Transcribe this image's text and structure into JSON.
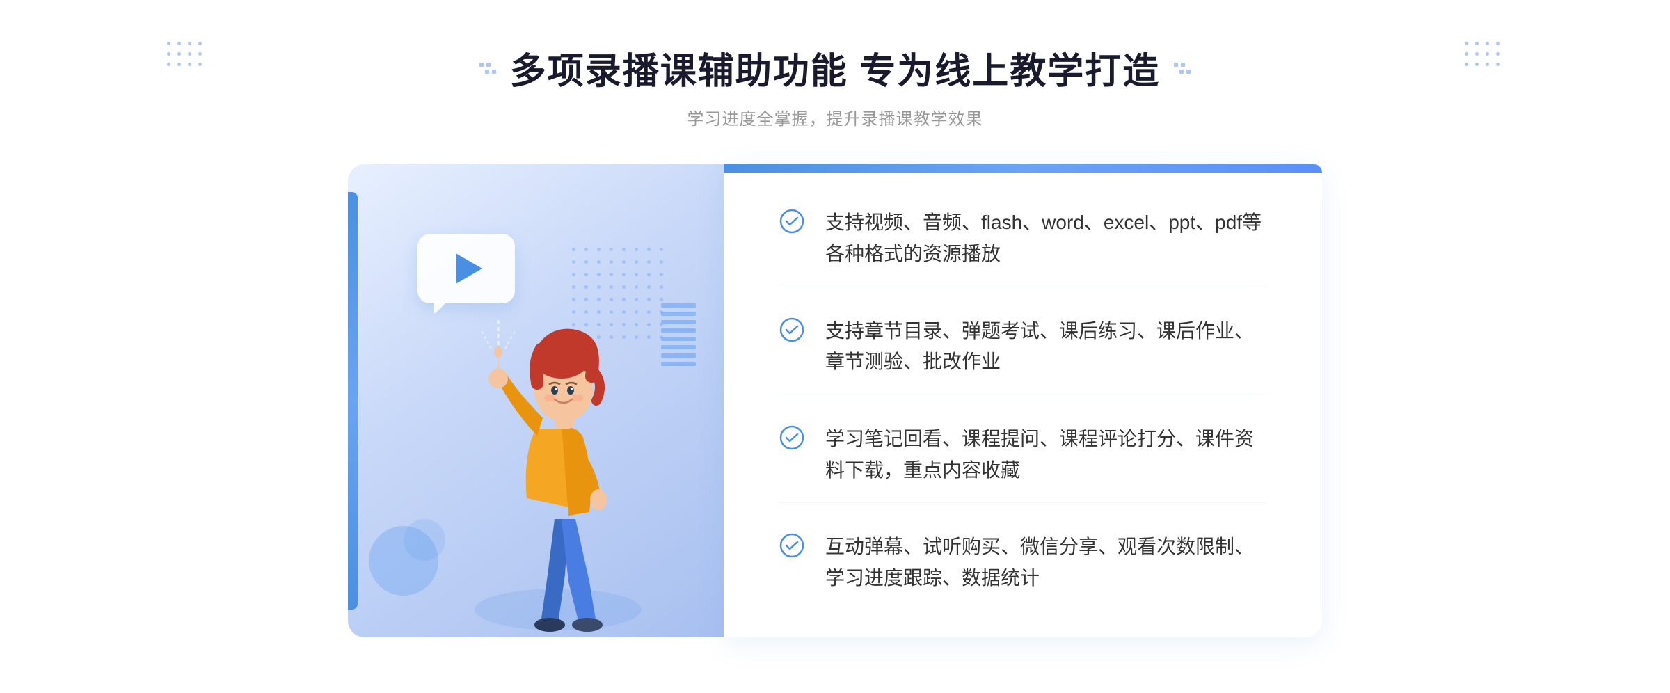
{
  "header": {
    "title": "多项录播课辅助功能 专为线上教学打造",
    "subtitle": "学习进度全掌握，提升录播课教学效果",
    "decoration_left": "⁚",
    "decoration_right": "⁚"
  },
  "features": [
    {
      "id": "feature-1",
      "text": "支持视频、音频、flash、word、excel、ppt、pdf等各种格式的资源播放"
    },
    {
      "id": "feature-2",
      "text": "支持章节目录、弹题考试、课后练习、课后作业、章节测验、批改作业"
    },
    {
      "id": "feature-3",
      "text": "学习笔记回看、课程提问、课程评论打分、课件资料下载，重点内容收藏"
    },
    {
      "id": "feature-4",
      "text": "互动弹幕、试听购买、微信分享、观看次数限制、学习进度跟踪、数据统计"
    }
  ],
  "colors": {
    "primary": "#4a90e2",
    "secondary": "#6aa3f5",
    "text_dark": "#1a1a2e",
    "text_gray": "#999999",
    "text_body": "#333333",
    "bg_white": "#ffffff",
    "bg_light": "#e8f0ff"
  }
}
